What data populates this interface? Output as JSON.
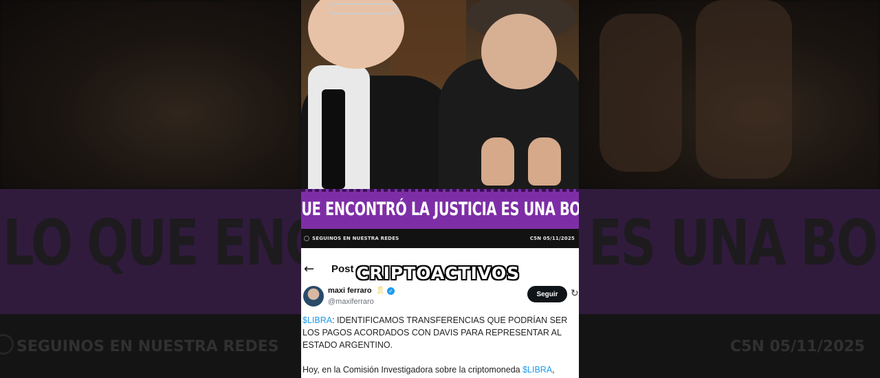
{
  "video": {
    "headline": "LO QUE ENCONTRÓ LA JUSTICIA ES UNA BOMBA",
    "footer_left": "SEGUINOS EN NUESTRA REDES",
    "footer_right": "C5N 05/11/2025",
    "overlay_caption": "CRIPTOACTIVOS",
    "side_band_left": "LO QUE ENCONTR",
    "side_band_right": "ES UNA BOMBA"
  },
  "tweet": {
    "back_label": "←",
    "page_label": "Post",
    "author_name": "maxi ferraro",
    "ribbon_icon": "🎗",
    "verified_icon": "✓",
    "handle": "@maxiferraro",
    "follow_label": "Seguir",
    "more_icon": "↻",
    "cashtag": "$LIBRA",
    "body_text": ": IDENTIFICAMOS TRANSFERENCIAS QUE PODRÍAN SER LOS PAGOS ACORDADOS CON DAVIS PARA REPRESENTAR AL ESTADO ARGENTINO.",
    "second_line_prefix": "Hoy, en la Comisión Investigadora sobre la criptomoneda ",
    "second_line_cashtag": "$LIBRA",
    "second_line_suffix": ","
  },
  "colors": {
    "accent_purple": "#7d2ea6",
    "link_blue": "#1d9bf0"
  }
}
